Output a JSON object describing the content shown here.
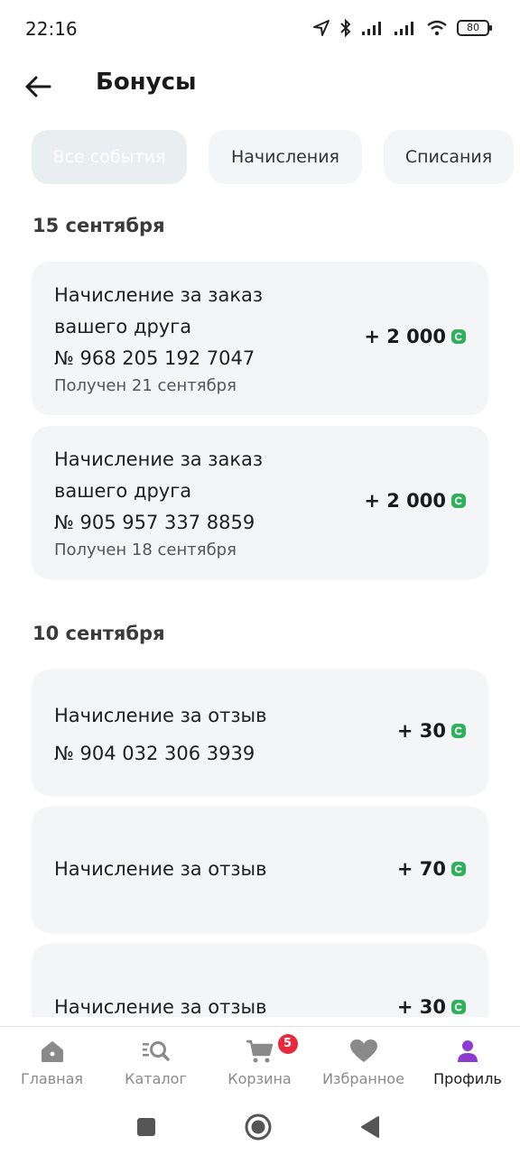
{
  "status_bar": {
    "time": "22:16",
    "battery": "80"
  },
  "header": {
    "title": "Бонусы"
  },
  "filters": [
    {
      "label": "Все события",
      "active": true
    },
    {
      "label": "Начисления",
      "active": false
    },
    {
      "label": "Списания",
      "active": false
    }
  ],
  "groups": [
    {
      "date": "15 сентября",
      "items": [
        {
          "title_line1": "Начисление за заказ",
          "title_line2": "вашего друга",
          "order": "№ 968 205 192 7047",
          "received": "Получен 21 сентября",
          "amount": "+ 2 000"
        },
        {
          "title_line1": "Начисление за заказ",
          "title_line2": "вашего друга",
          "order": "№ 905 957 337 8859",
          "received": "Получен 18 сентября",
          "amount": "+ 2 000"
        }
      ]
    },
    {
      "date": "10 сентября",
      "items": [
        {
          "title_line1": "Начисление за отзыв",
          "order": "№ 904 032 306 3939",
          "amount": "+ 30"
        },
        {
          "title_line1": "Начисление за отзыв",
          "amount": "+ 70"
        },
        {
          "title_line1": "Начисление за отзыв",
          "amount": "+ 30"
        }
      ]
    }
  ],
  "bottom_nav": [
    {
      "label": "Главная",
      "icon": "home-icon"
    },
    {
      "label": "Каталог",
      "icon": "catalog-search-icon"
    },
    {
      "label": "Корзина",
      "icon": "cart-icon",
      "badge": "5"
    },
    {
      "label": "Избранное",
      "icon": "heart-icon"
    },
    {
      "label": "Профиль",
      "icon": "profile-icon",
      "active": true
    }
  ],
  "colors": {
    "accent": "#8e3bd1",
    "bonus": "#2fb05c",
    "badge": "#e8283c",
    "card_bg": "#f3f5f7"
  }
}
